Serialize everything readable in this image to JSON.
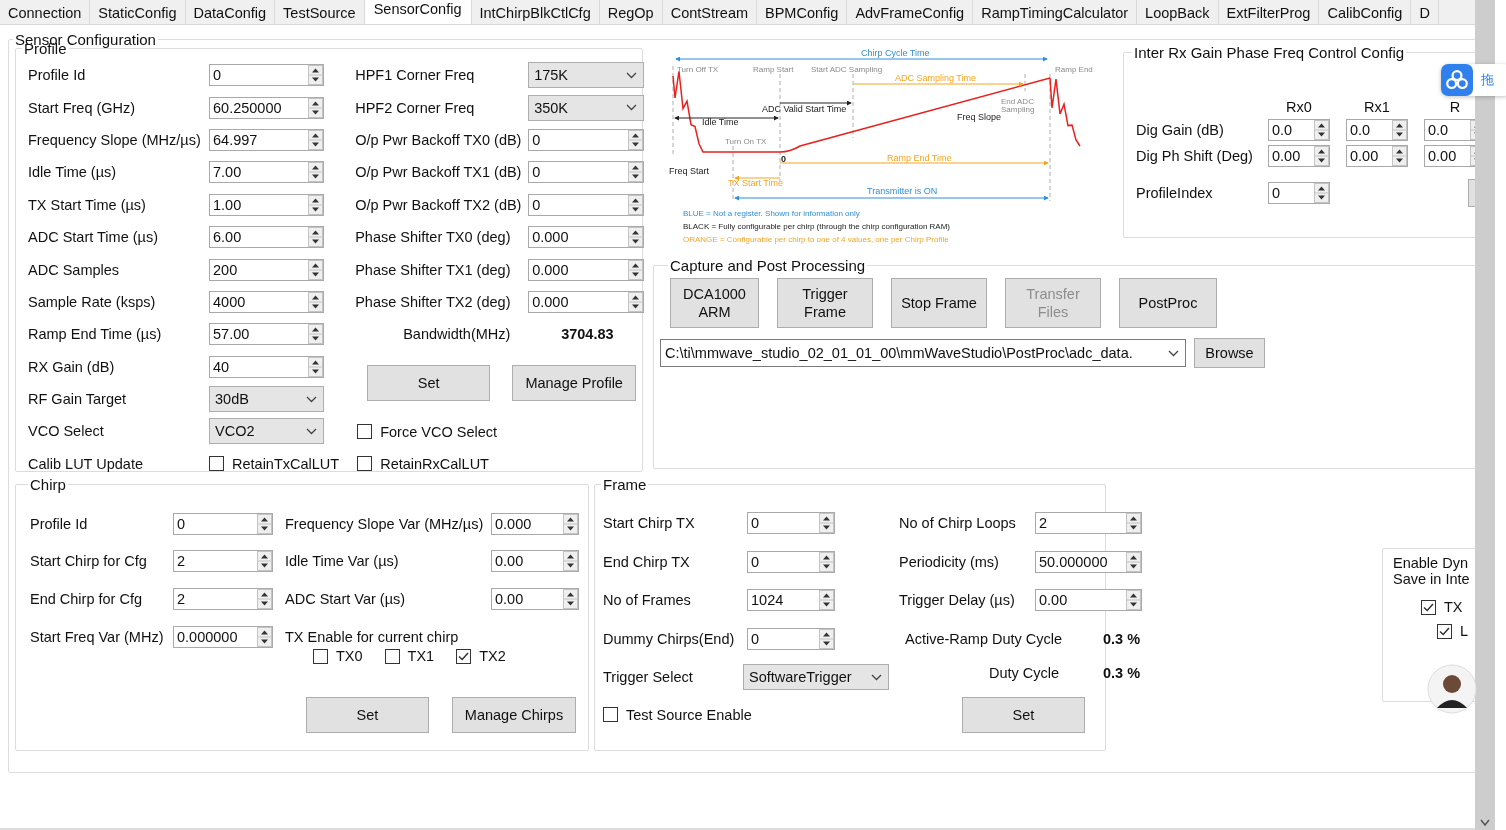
{
  "tabs": [
    {
      "label": "Connection",
      "selected": false
    },
    {
      "label": "StaticConfig",
      "selected": false
    },
    {
      "label": "DataConfig",
      "selected": false
    },
    {
      "label": "TestSource",
      "selected": false
    },
    {
      "label": "SensorConfig",
      "selected": true
    },
    {
      "label": "IntChirpBlkCtlCfg",
      "selected": false
    },
    {
      "label": "RegOp",
      "selected": false
    },
    {
      "label": "ContStream",
      "selected": false
    },
    {
      "label": "BPMConfig",
      "selected": false
    },
    {
      "label": "AdvFrameConfig",
      "selected": false
    },
    {
      "label": "RampTimingCalculator",
      "selected": false
    },
    {
      "label": "LoopBack",
      "selected": false
    },
    {
      "label": "ExtFilterProg",
      "selected": false
    },
    {
      "label": "CalibConfig",
      "selected": false
    },
    {
      "label": "D",
      "selected": false
    }
  ],
  "sensor_config": {
    "title": "Sensor Configuration",
    "profile": {
      "title": "Profile",
      "left": [
        {
          "label": "Profile Id",
          "kind": "spin",
          "value": "0"
        },
        {
          "label": "Start Freq (GHz)",
          "kind": "spin",
          "value": "60.250000"
        },
        {
          "label": "Frequency Slope (MHz/µs)",
          "kind": "spin",
          "value": "64.997"
        },
        {
          "label": "Idle Time (µs)",
          "kind": "spin",
          "value": "7.00"
        },
        {
          "label": "TX Start Time (µs)",
          "kind": "spin",
          "value": "1.00"
        },
        {
          "label": "ADC Start Time (µs)",
          "kind": "spin",
          "value": "6.00"
        },
        {
          "label": "ADC Samples",
          "kind": "spin",
          "value": "200"
        },
        {
          "label": "Sample Rate (ksps)",
          "kind": "spin",
          "value": "4000"
        },
        {
          "label": "Ramp End Time (µs)",
          "kind": "spin",
          "value": "57.00"
        },
        {
          "label": "RX Gain (dB)",
          "kind": "spin",
          "value": "40"
        },
        {
          "label": "RF Gain Target",
          "kind": "select",
          "value": "30dB"
        },
        {
          "label": "VCO Select",
          "kind": "select",
          "value": "VCO2"
        },
        {
          "label": "Calib LUT Update",
          "kind": "check",
          "check_label": "RetainTxCalLUT",
          "checked": false
        }
      ],
      "right": [
        {
          "label": "HPF1 Corner Freq",
          "kind": "select",
          "value": "175K"
        },
        {
          "label": "HPF2 Corner Freq",
          "kind": "select",
          "value": "350K"
        },
        {
          "label": "O/p Pwr Backoff TX0 (dB)",
          "kind": "spin",
          "value": "0"
        },
        {
          "label": "O/p Pwr Backoff TX1 (dB)",
          "kind": "spin",
          "value": "0"
        },
        {
          "label": "O/p Pwr Backoff TX2 (dB)",
          "kind": "spin",
          "value": "0"
        },
        {
          "label": "Phase Shifter TX0 (deg)",
          "kind": "spin",
          "value": "0.000"
        },
        {
          "label": "Phase Shifter TX1 (deg)",
          "kind": "spin",
          "value": "0.000"
        },
        {
          "label": "Phase Shifter TX2 (deg)",
          "kind": "spin",
          "value": "0.000"
        },
        {
          "label": "Bandwidth(MHz)",
          "kind": "readout",
          "value": "3704.83"
        },
        {
          "kind": "buttons",
          "buttons": [
            "Set",
            "Manage Profile"
          ]
        },
        {
          "kind": "check",
          "check_label": "Force VCO Select",
          "checked": false
        },
        {
          "kind": "check",
          "check_label": "RetainRxCalLUT",
          "checked": false
        }
      ]
    },
    "diagram": {
      "labels": [
        {
          "text": "Chirp Cycle Time",
          "kind": "info"
        },
        {
          "text": "Turn Off TX",
          "kind": "marker"
        },
        {
          "text": "Ramp Start",
          "kind": "marker"
        },
        {
          "text": "Start ADC Sampling",
          "kind": "marker"
        },
        {
          "text": "Ramp End",
          "kind": "marker"
        },
        {
          "text": "ADC Sampling Time",
          "kind": "profile"
        },
        {
          "text": "ADC Valid Start Time",
          "kind": "register"
        },
        {
          "text": "End ADC",
          "kind": "marker"
        },
        {
          "text": "Sampling",
          "kind": "marker"
        },
        {
          "text": "Freq Slope",
          "kind": "register"
        },
        {
          "text": "Idle Time",
          "kind": "register"
        },
        {
          "text": "Turn On TX",
          "kind": "marker"
        },
        {
          "text": "0",
          "kind": "register"
        },
        {
          "text": "Ramp End Time",
          "kind": "profile"
        },
        {
          "text": "Freq Start",
          "kind": "register"
        },
        {
          "text": "TX Start Time",
          "kind": "profile"
        },
        {
          "text": "Transmitter is ON",
          "kind": "info"
        },
        {
          "text": "BLUE = Not a register. Shown for information only",
          "kind": "info"
        },
        {
          "text": "BLACK = Fully configurable per chirp (through the chirp configuration RAM)",
          "kind": "register"
        },
        {
          "text": "ORANGE = Configurable per chirp to one of 4 values, one per Chirp Profile",
          "kind": "profile"
        }
      ]
    },
    "inter_rx": {
      "title": "Inter Rx Gain Phase Freq Control Config",
      "columns": [
        "Rx0",
        "Rx1",
        "R"
      ],
      "rows": [
        {
          "label": "Dig Gain (dB)",
          "values": [
            "0.0",
            "0.0",
            "0.0"
          ]
        },
        {
          "label": "Dig Ph Shift (Deg)",
          "values": [
            "0.00",
            "0.00",
            "0.00"
          ]
        }
      ],
      "profile_index": {
        "label": "ProfileIndex",
        "value": "0"
      }
    },
    "capture": {
      "title": "Capture and Post Processing",
      "buttons": [
        {
          "label": "DCA1000\nARM",
          "disabled": false
        },
        {
          "label": "Trigger\nFrame",
          "disabled": false
        },
        {
          "label": "Stop Frame",
          "disabled": false
        },
        {
          "label": "Transfer\nFiles",
          "disabled": true
        },
        {
          "label": "PostProc",
          "disabled": false
        }
      ],
      "path": "C:\\ti\\mmwave_studio_02_01_01_00\\mmWaveStudio\\PostProc\\adc_data.",
      "browse": "Browse"
    },
    "chirp": {
      "title": "Chirp",
      "left": [
        {
          "label": "Profile Id",
          "kind": "spin",
          "value": "0"
        },
        {
          "label": "Start Chirp for Cfg",
          "kind": "spin",
          "value": "2"
        },
        {
          "label": "End Chirp for Cfg",
          "kind": "spin",
          "value": "2"
        },
        {
          "label": "Start Freq Var (MHz)",
          "kind": "spin",
          "value": "0.000000"
        }
      ],
      "right": [
        {
          "label": "Frequency Slope Var (MHz/µs)",
          "kind": "spin",
          "value": "0.000"
        },
        {
          "label": "Idle Time Var (µs)",
          "kind": "spin",
          "value": "0.00"
        },
        {
          "label": "ADC Start Var (µs)",
          "kind": "spin",
          "value": "0.00"
        },
        {
          "label": "TX Enable for current chirp",
          "kind": "caption"
        }
      ],
      "tx_enable": [
        {
          "label": "TX0",
          "checked": false
        },
        {
          "label": "TX1",
          "checked": false
        },
        {
          "label": "TX2",
          "checked": true
        }
      ],
      "buttons": [
        "Set",
        "Manage Chirps"
      ]
    },
    "frame": {
      "title": "Frame",
      "left": [
        {
          "label": "Start Chirp TX",
          "kind": "spin",
          "value": "0"
        },
        {
          "label": "End Chirp TX",
          "kind": "spin",
          "value": "0"
        },
        {
          "label": "No of Frames",
          "kind": "spin",
          "value": "1024"
        },
        {
          "label": "Dummy Chirps(End)",
          "kind": "spin",
          "value": "0"
        },
        {
          "label": "Trigger Select",
          "kind": "select",
          "value": "SoftwareTrigger"
        }
      ],
      "right": [
        {
          "label": "No of Chirp Loops",
          "kind": "spin",
          "value": "2"
        },
        {
          "label": "Periodicity (ms)",
          "kind": "spin",
          "value": "50.000000"
        },
        {
          "label": "Trigger Delay (µs)",
          "kind": "spin",
          "value": "0.00"
        },
        {
          "label": "Active-Ramp Duty Cycle",
          "kind": "readout",
          "value": "0.3 %"
        },
        {
          "label": "Duty Cycle",
          "kind": "readout",
          "value": "0.3 %"
        }
      ],
      "test_source": {
        "label": "Test Source Enable",
        "checked": false
      },
      "set": "Set"
    },
    "dyn_save": {
      "lines": [
        "Enable Dyn",
        "Save in Inte"
      ],
      "options": [
        {
          "label": "TX",
          "checked": true
        },
        {
          "label": "L",
          "checked": true
        }
      ]
    }
  },
  "floating_button": {
    "label": "拖"
  }
}
